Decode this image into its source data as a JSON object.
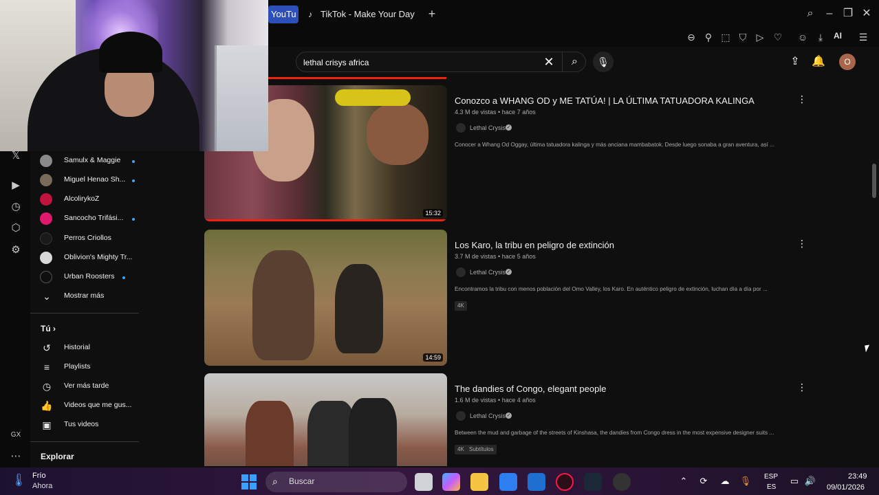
{
  "browser": {
    "tabs": [
      {
        "label": "YouTu"
      },
      {
        "label": "TikTok - Make Your Day"
      }
    ],
    "new_tab": "+",
    "toolbar_ai": "AI"
  },
  "search": {
    "query": "lethal crisys africa"
  },
  "header": {
    "avatar_letter": "O"
  },
  "guide": {
    "subscriptions": [
      {
        "name": "Samulx & Maggie",
        "new": true,
        "color": "#8a8a8a"
      },
      {
        "name": "Miguel Henao Sh...",
        "new": true,
        "color": "#7a6a5a"
      },
      {
        "name": "AlcolirykoZ",
        "new": false,
        "color": "#c0143c"
      },
      {
        "name": "Sancocho Trifási...",
        "new": true,
        "color": "#e0196e"
      },
      {
        "name": "Perros Criollos",
        "new": false,
        "color": "#1a1a1a"
      },
      {
        "name": "Oblivion's Mighty Tr...",
        "new": false,
        "color": "#d9d9d9"
      },
      {
        "name": "Urban Roosters",
        "new": true,
        "color": "#0f0f0f"
      }
    ],
    "show_more": "Mostrar más",
    "you_section": "Tú",
    "you_items": [
      {
        "label": "Historial",
        "icon": "history-icon"
      },
      {
        "label": "Playlists",
        "icon": "playlists-icon"
      },
      {
        "label": "Ver más tarde",
        "icon": "watch-later-icon"
      },
      {
        "label": "Videos que me gus...",
        "icon": "thumbs-up-icon"
      },
      {
        "label": "Tus videos",
        "icon": "your-videos-icon"
      }
    ],
    "explore": "Explorar"
  },
  "rail": {
    "gx": "GX"
  },
  "videos": [
    {
      "title": "Conozco a WHANG OD y ME TATÚA! | LA ÚLTIMA TATUADORA KALINGA",
      "views": "4.3 M de vistas",
      "age": "hace 7 años",
      "channel": "Lethal Crysis",
      "description": "Conocer a Whang Od Oggay, última tatuadora kalinga y más anciana mambabatok. Desde luego sonaba a gran aventura, así ...",
      "duration": "15:32",
      "badges": [],
      "watched_fraction": 1.0
    },
    {
      "title": "Los Karo, la tribu en peligro de extinción",
      "views": "3.7 M de vistas",
      "age": "hace 5 años",
      "channel": "Lethal Crysis",
      "description": "Encontramos la tribu con menos población del Omo Valley, los Karo. En auténtico peligro de extinción, luchan día a día por ...",
      "duration": "14:59",
      "badges": [
        "4K"
      ],
      "watched_fraction": 0
    },
    {
      "title": "The dandies of Congo, elegant people",
      "views": "1.6 M de vistas",
      "age": "hace 4 años",
      "channel": "Lethal Crysis",
      "description": "Between the mud and garbage of the streets of Kinshasa, the dandies from Congo dress in the most expensive designer suits ...",
      "duration": "",
      "badges": [
        "4K",
        "Subtítulos"
      ],
      "watched_fraction": 0
    }
  ],
  "meta_separator": "•",
  "taskbar": {
    "weather_temp": "Frío",
    "weather_cond": "Ahora",
    "search_label": "Buscar",
    "lang_top": "ESP",
    "lang_bottom": "ES",
    "time": "23:49",
    "date": "09/01/2026"
  }
}
